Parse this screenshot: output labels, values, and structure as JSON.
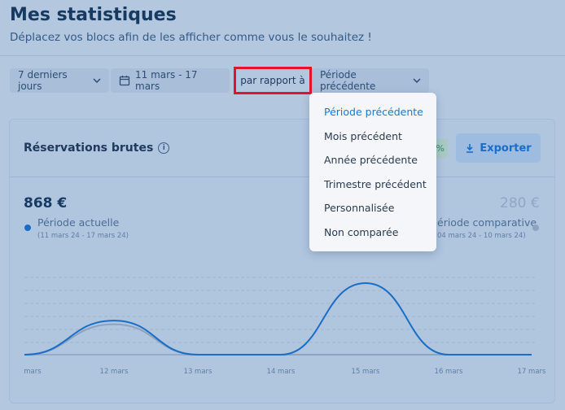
{
  "header": {
    "title": "Mes statistiques",
    "subtitle": "Déplacez vos blocs afin de les afficher comme vous le souhaitez !"
  },
  "filters": {
    "period_label": "7 derniers jours",
    "date_range": "11 mars - 17 mars",
    "compare_label": "par rapport à",
    "compare_selected": "Période précédente"
  },
  "dropdown": {
    "options": [
      "Période précédente",
      "Mois précédent",
      "Année précédente",
      "Trimestre précédent",
      "Personnalisée",
      "Non comparée"
    ],
    "selected_index": 0
  },
  "card": {
    "title": "Réservations brutes",
    "badge": "%",
    "export_label": "Exporter",
    "current": {
      "value": "868 €",
      "label": "Période actuelle",
      "range": "(11 mars 24 - 17 mars 24)"
    },
    "comparison": {
      "value": "280 €",
      "label": "ériode comparative",
      "range": "04 mars 24 - 10 mars 24)"
    }
  },
  "colors": {
    "current": "#1a6ec7",
    "comparison": "#8ea3bd",
    "highlight": "#e3142a"
  },
  "chart_data": {
    "type": "line",
    "x": [
      "mars",
      "12 mars",
      "13 mars",
      "14 mars",
      "15 mars",
      "16 mars",
      "17 mars"
    ],
    "series": [
      {
        "name": "Période actuelle",
        "values": [
          0,
          280,
          0,
          0,
          588,
          0,
          0
        ]
      },
      {
        "name": "Période comparative",
        "values": [
          0,
          250,
          0,
          0,
          0,
          0,
          0
        ]
      }
    ],
    "grid": true
  }
}
